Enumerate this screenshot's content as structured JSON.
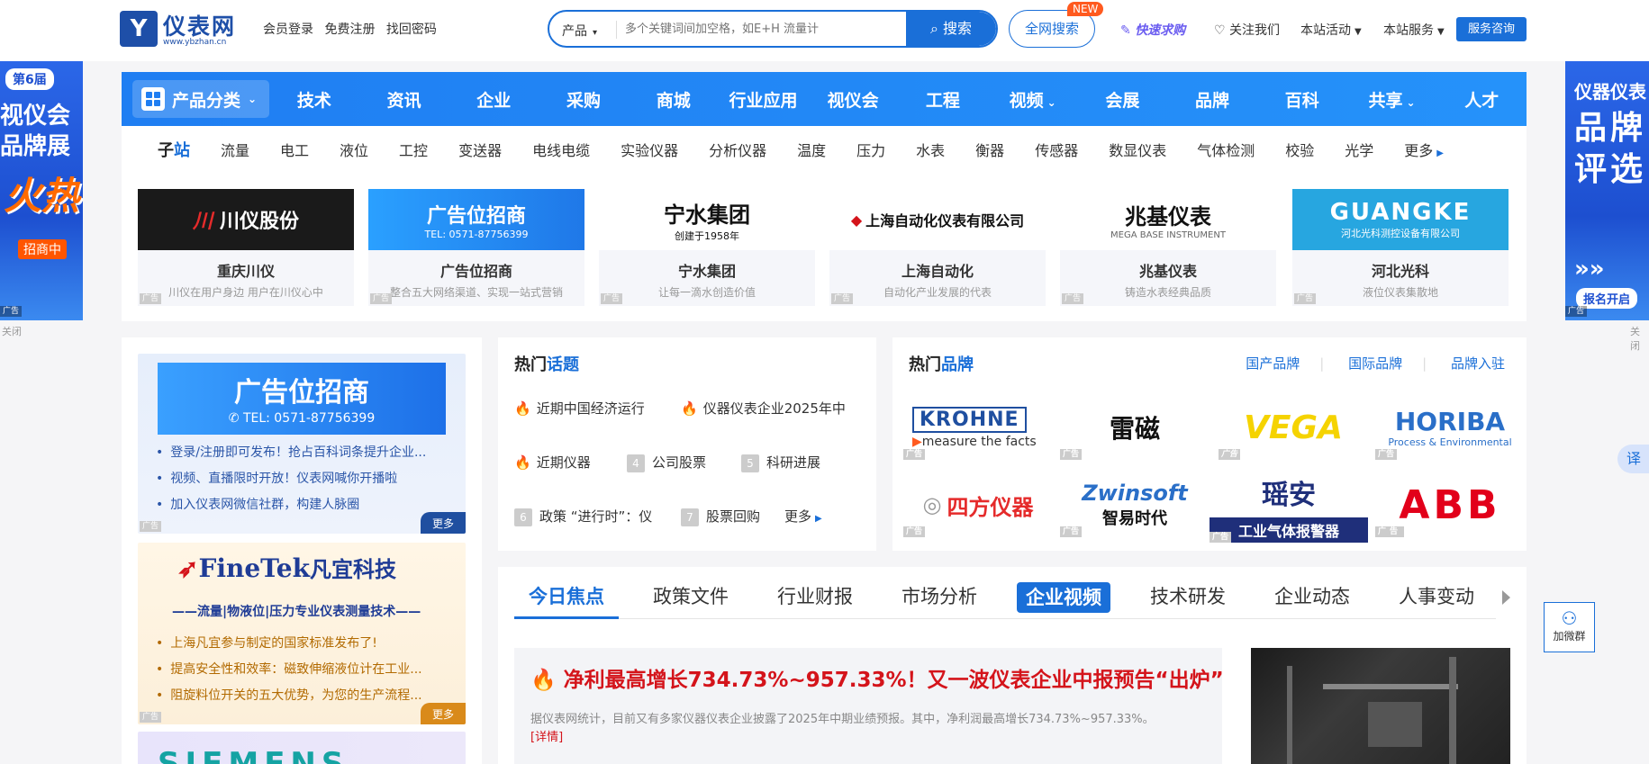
{
  "header": {
    "logo": {
      "name": "仪表网",
      "url": "www.ybzhan.cn",
      "mark": "Y"
    },
    "links": [
      "会员登录",
      "免费注册",
      "找回密码"
    ],
    "search": {
      "category": "产品",
      "placeholder": "多个关键词间加空格，如E+H 流量计",
      "button": "搜索"
    },
    "all_search": "全网搜索",
    "new_badge": "NEW",
    "right_links": [
      "快速求购",
      "关注我们",
      "本站活动",
      "本站服务"
    ],
    "consult": "服务咨询"
  },
  "side_ads": {
    "left": {
      "edition": "第6届",
      "title": "视仪会品牌展",
      "hot": "火热",
      "cta": "招商中",
      "ad": "广告",
      "close": "关闭"
    },
    "right": {
      "title": "仪器仪表",
      "big": "品牌评选",
      "cta": "报名开启",
      "ad": "广告",
      "close": "关闭"
    }
  },
  "nav": {
    "category": "产品分类",
    "items": [
      "技术",
      "资讯",
      "企业",
      "采购",
      "商城",
      "行业应用",
      "视仪会",
      "工程",
      "视频",
      "会展",
      "品牌",
      "百科",
      "共享",
      "人才"
    ]
  },
  "substations": {
    "label_a": "子",
    "label_b": "站",
    "items": [
      "流量",
      "电工",
      "液位",
      "工控",
      "变送器",
      "电线电缆",
      "实验仪器",
      "分析仪器",
      "温度",
      "压力",
      "水表",
      "衡器",
      "传感器",
      "数显仪表",
      "气体检测",
      "校验",
      "光学"
    ],
    "more": "更多"
  },
  "brand_ads": [
    {
      "logo": "川仪股份",
      "title": "重庆川仪",
      "desc": "川仪在用户身边 用户在川仪心中",
      "ad": "广告"
    },
    {
      "logo": "广告位招商",
      "sub": "TEL: 0571-87756399",
      "title": "广告位招商",
      "desc": "整合五大网络渠道、实现一站式营销",
      "ad": "广告"
    },
    {
      "logo": "宁水集团",
      "sub": "创建于1958年",
      "title": "宁水集团",
      "desc": "让每一滴水创造价值",
      "ad": "广告"
    },
    {
      "logo": "上海自动化仪表有限公司",
      "title": "上海自动化",
      "desc": "自动化产业发展的代表",
      "ad": "广告"
    },
    {
      "logo": "兆基仪表",
      "sub": "MEGA BASE INSTRUMENT",
      "title": "兆基仪表",
      "desc": "铸造水表经典品质",
      "ad": "广告"
    },
    {
      "logo": "GUANGKE",
      "sub": "河北光科测控设备有限公司",
      "title": "河北光科",
      "desc": "液位仪表集散地",
      "ad": "广告"
    }
  ],
  "left_ads": {
    "ad1": {
      "banner": "广告位招商",
      "tel": "TEL: 0571-87756399",
      "items": [
        "登录/注册即可发布！抢占百科词条提升企业...",
        "视频、直播限时开放！仪表网喊你开播啦",
        "加入仪表网微信社群，构建人脉圈"
      ],
      "more": "更多",
      "ad": "广告"
    },
    "ad2": {
      "logo": "FineTek",
      "logo_cn": "凡宜科技",
      "tagline": "——流量|物液位|压力专业仪表测量技术——",
      "items": [
        "上海凡宜参与制定的国家标准发布了!",
        "提高安全性和效率：磁致伸缩液位计在工业...",
        "阻旋料位开关的五大优势，为您的生产流程..."
      ],
      "more": "更多",
      "ad": "广告"
    },
    "ad3": {
      "logo": "SIEMENS"
    }
  },
  "hot_topics": {
    "title_a": "热门",
    "title_b": "话题",
    "items": [
      {
        "rank": "fire",
        "text": "近期中国经济运行"
      },
      {
        "rank": "fire",
        "text": "仪器仪表企业2025年中"
      },
      {
        "rank": "fire",
        "text": "近期仪器"
      },
      {
        "rank": "4",
        "text": "公司股票"
      },
      {
        "rank": "5",
        "text": "科研进展"
      },
      {
        "rank": "6",
        "text": "政策 “进行时”：仪"
      },
      {
        "rank": "7",
        "text": "股票回购"
      }
    ],
    "more": "更多"
  },
  "hot_brands": {
    "title_a": "热门",
    "title_b": "品牌",
    "links": [
      "国产品牌",
      "国际品牌",
      "品牌入驻"
    ],
    "logos": [
      {
        "name": "KROHNE",
        "sub": "measure the facts"
      },
      {
        "name": "雷磁"
      },
      {
        "name": "VEGA"
      },
      {
        "name": "HORIBA",
        "sub": "Process & Environmental"
      },
      {
        "name": "四方仪器"
      },
      {
        "name": "Zwinsoft",
        "sub": "智易时代"
      },
      {
        "name": "瑶安",
        "sub": "工业气体报警器"
      },
      {
        "name": "ABB"
      }
    ],
    "ad": "广告"
  },
  "focus": {
    "tabs": [
      "今日焦点",
      "政策文件",
      "行业财报",
      "市场分析",
      "企业视频",
      "技术研发",
      "企业动态",
      "人事变动"
    ],
    "headline": "净利最高增长734.73%~957.33%！又一波仪表企业中报预告“出炉”",
    "desc": "据仪表网统计，目前又有多家仪器仪表企业披露了2025年中期业绩预报。其中，净利润最高增长734.73%~957.33%。",
    "detail": "[详情]"
  },
  "float": {
    "translate": "译",
    "wechat": "加微群"
  }
}
